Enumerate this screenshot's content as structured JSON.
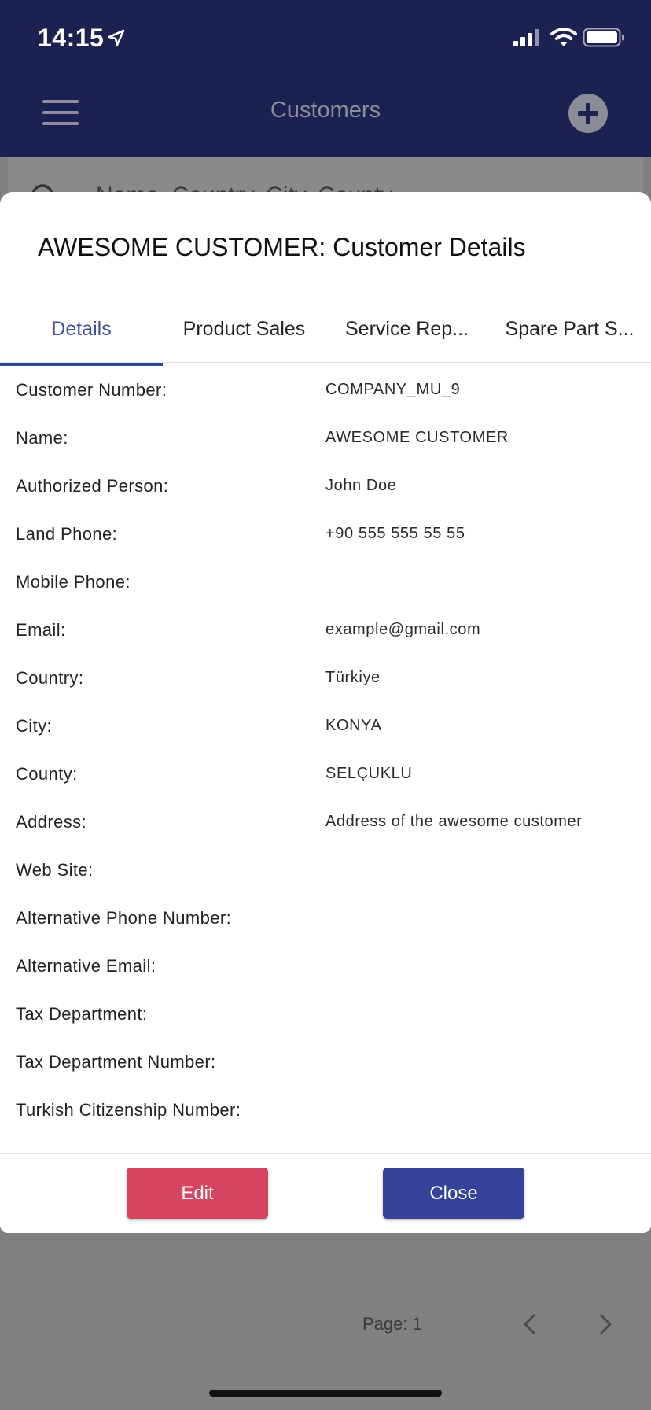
{
  "status_bar": {
    "time": "14:15"
  },
  "nav": {
    "title": "Customers"
  },
  "search": {
    "placeholder": "Name, Country, City, County"
  },
  "pager": {
    "label": "Page: 1"
  },
  "modal": {
    "title": "AWESOME CUSTOMER: Customer Details",
    "tabs": [
      {
        "label": "Details",
        "active": true
      },
      {
        "label": "Product Sales",
        "active": false
      },
      {
        "label": "Service Rep...",
        "active": false
      },
      {
        "label": "Spare Part S...",
        "active": false
      }
    ],
    "fields": [
      {
        "label": "Customer Number:",
        "value": "COMPANY_MU_9"
      },
      {
        "label": "Name:",
        "value": "AWESOME CUSTOMER"
      },
      {
        "label": "Authorized Person:",
        "value": "John Doe"
      },
      {
        "label": "Land Phone:",
        "value": "+90 555 555 55 55"
      },
      {
        "label": "Mobile Phone:",
        "value": ""
      },
      {
        "label": "Email:",
        "value": "example@gmail.com"
      },
      {
        "label": "Country:",
        "value": "Türkiye"
      },
      {
        "label": "City:",
        "value": "KONYA"
      },
      {
        "label": "County:",
        "value": "SELÇUKLU"
      },
      {
        "label": "Address:",
        "value": "Address of the awesome customer"
      },
      {
        "label": "Web Site:",
        "value": ""
      },
      {
        "label": "Alternative Phone Number:",
        "value": ""
      },
      {
        "label": "Alternative Email:",
        "value": ""
      },
      {
        "label": "Tax Department:",
        "value": ""
      },
      {
        "label": "Tax Department Number:",
        "value": ""
      },
      {
        "label": "Turkish Citizenship Number:",
        "value": ""
      }
    ],
    "edit_label": "Edit",
    "close_label": "Close"
  },
  "colors": {
    "header_bg": "#1b2150",
    "accent": "#34459e",
    "edit_button": "#d6455f",
    "close_button": "#34429a",
    "overlay": "#808080"
  }
}
